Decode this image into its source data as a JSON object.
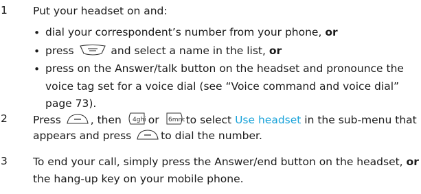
{
  "steps": [
    {
      "number": "1",
      "intro": "Put your headset on and:",
      "bullets": [
        {
          "before": "dial your correspondent’s number from your phone, ",
          "bold": "or"
        },
        {
          "before": "press",
          "after": " and select a name in the list, ",
          "bold": "or",
          "icon": "menu-key-icon"
        },
        {
          "lines": [
            "press on the Answer/talk button on the headset and pronounce the",
            "voice tag set for a voice dial (see “Voice command and voice dial”",
            "page 73)."
          ]
        }
      ]
    },
    {
      "number": "2",
      "part1": "Press",
      "part2": ", then",
      "part3": "or",
      "part4": "to select",
      "highlight": "Use headset",
      "part5": "in the sub-menu that",
      "line2a": "appears and press",
      "line2b": "to dial the number.",
      "icons": [
        "call-key-icon",
        "key-4-icon",
        "key-6-icon",
        "call-key-icon"
      ]
    },
    {
      "number": "3",
      "line1a": "To end your call, simply press the Answer/end button on the headset, ",
      "line1bold": "or",
      "line2": "the hang-up key on your mobile phone."
    }
  ],
  "colors": {
    "text": "#1a1a1a",
    "highlight": "#1aa3d9"
  }
}
